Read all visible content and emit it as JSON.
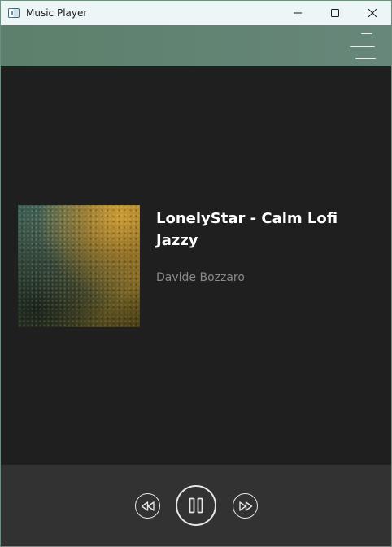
{
  "window": {
    "title": "Music Player",
    "icons": {
      "app": "app-window-icon",
      "minimize": "minimize-icon",
      "maximize": "maximize-icon",
      "close": "close-icon"
    }
  },
  "header": {
    "menu_icon": "hamburger-menu-icon",
    "color": "#5f8270"
  },
  "now_playing": {
    "title": "LonelyStar - Calm Lofi Jazzy",
    "artist": "Davide Bozzaro",
    "album_art": "album-cover-image"
  },
  "controls": {
    "rewind_icon": "rewind-icon",
    "pause_icon": "pause-icon",
    "forward_icon": "fast-forward-icon"
  },
  "colors": {
    "background": "#1f1f1f",
    "controls_bar": "#323232",
    "title_text": "#ffffff",
    "artist_text": "#8a8a8a"
  }
}
